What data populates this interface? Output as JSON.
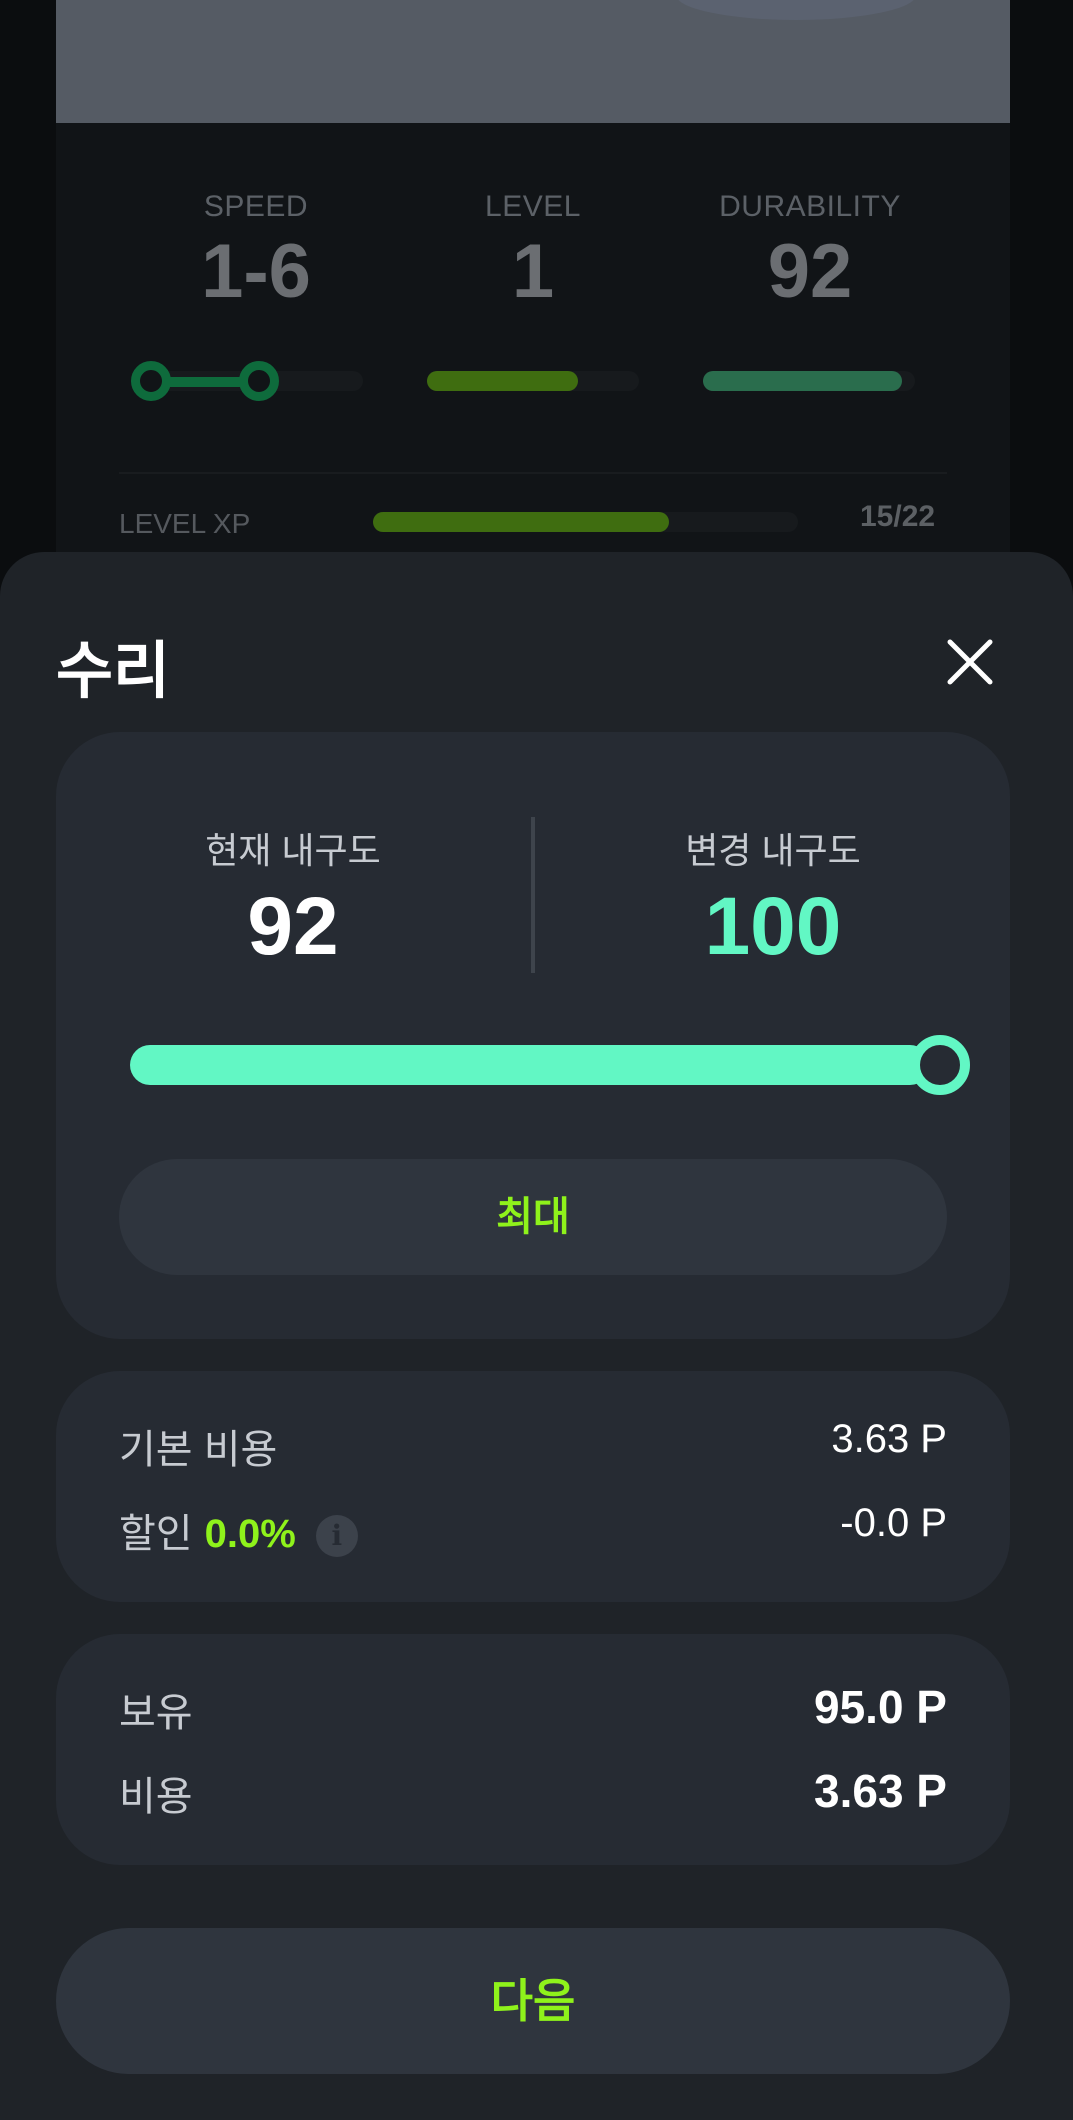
{
  "background": {
    "stats": {
      "speed": {
        "label": "SPEED",
        "value": "1-6"
      },
      "level": {
        "label": "LEVEL",
        "value": "1",
        "bar_fraction": 0.71
      },
      "durability": {
        "label": "DURABILITY",
        "value": "92",
        "bar_fraction": 0.92
      }
    },
    "level_xp": {
      "label": "LEVEL XP",
      "value": "15/22",
      "fraction": 0.682
    }
  },
  "sheet": {
    "title": "수리",
    "durability": {
      "current_label": "현재 내구도",
      "current_value": "92",
      "new_label": "변경 내구도",
      "new_value": "100",
      "slider_fraction": 1.0
    },
    "max_label": "최대",
    "cost": {
      "base_label": "기본 비용",
      "base_value": "3.63 P",
      "discount_label": "할인",
      "discount_pct": "0.0%",
      "discount_value": "-0.0 P"
    },
    "balance": {
      "owned_label": "보유",
      "owned_value": "95.0 P",
      "cost_label": "비용",
      "cost_value": "3.63 P"
    },
    "next_label": "다음"
  },
  "colors": {
    "accent_green": "#8ff21b",
    "mint": "#62f7c4",
    "sheet_bg": "#1f2328",
    "panel_bg": "#262b33"
  },
  "icons": [
    "close-icon",
    "info-icon"
  ]
}
